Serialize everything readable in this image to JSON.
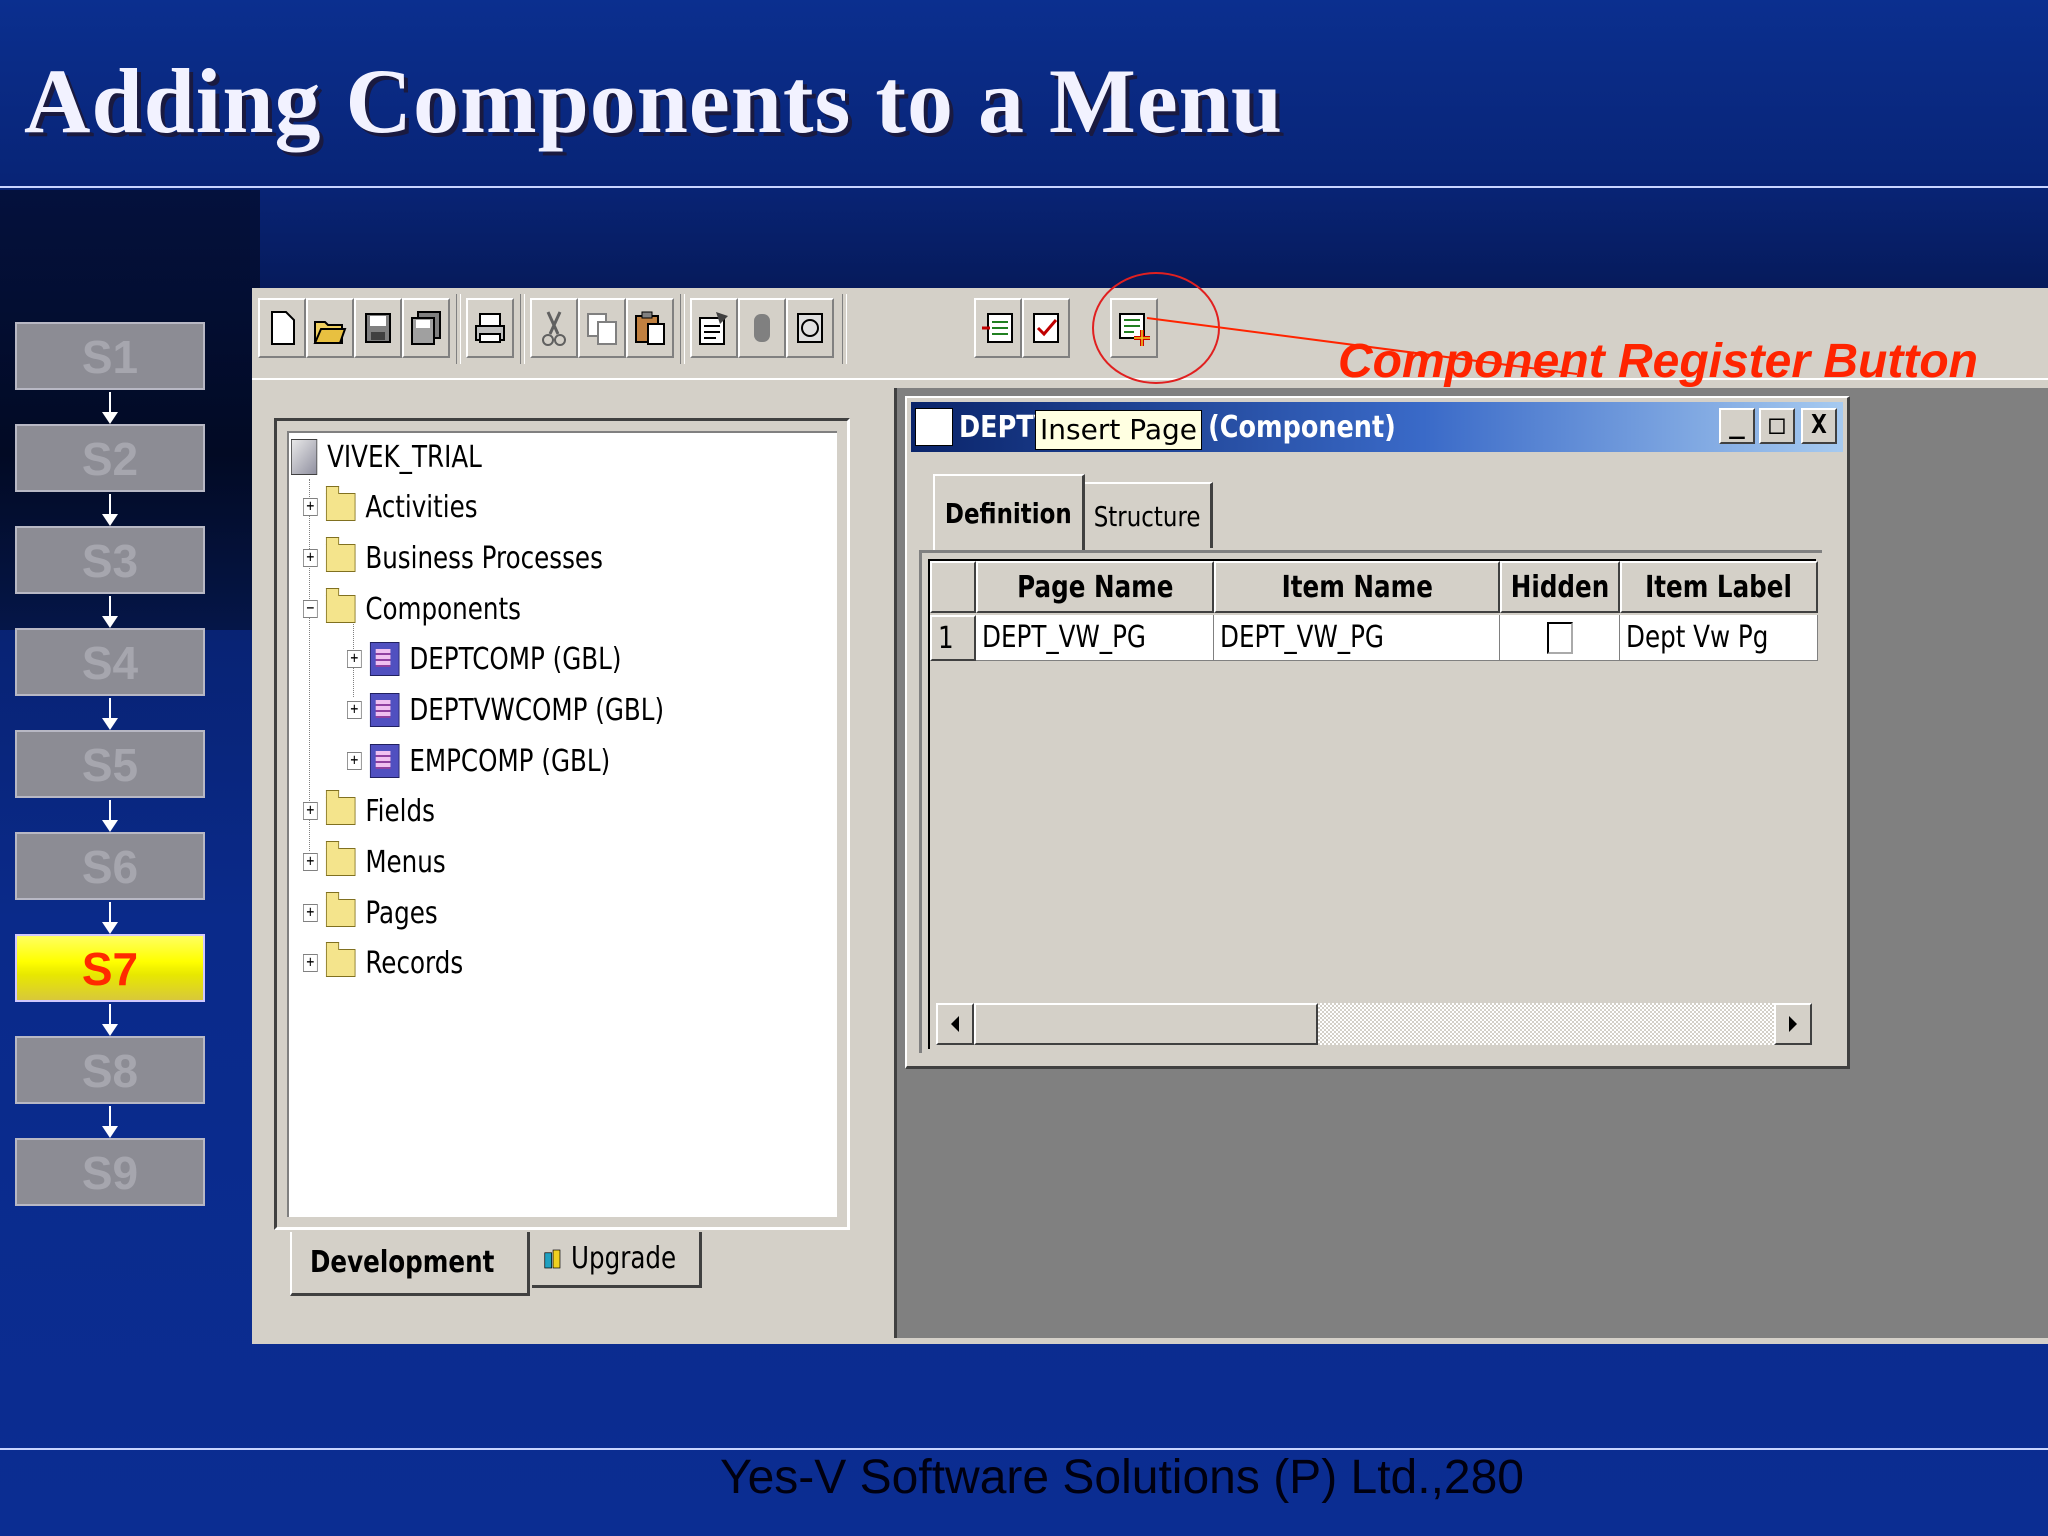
{
  "slide": {
    "title": "Adding Components to a Menu",
    "footer": "Yes-V Software Solutions (P) Ltd.,280",
    "callout": "Component Register Button"
  },
  "steps": [
    {
      "label": "S1",
      "active": false
    },
    {
      "label": "S2",
      "active": false
    },
    {
      "label": "S3",
      "active": false
    },
    {
      "label": "S4",
      "active": false
    },
    {
      "label": "S5",
      "active": false
    },
    {
      "label": "S6",
      "active": false
    },
    {
      "label": "S7",
      "active": true
    },
    {
      "label": "S8",
      "active": false
    },
    {
      "label": "S9",
      "active": false
    }
  ],
  "toolbar": {
    "buttons": [
      "new-icon",
      "open-icon",
      "save-icon",
      "save-all-icon",
      "print-icon",
      "cut-icon",
      "copy-icon",
      "paste-icon",
      "properties-icon",
      "close-icon",
      "project-icon",
      "insert-page-icon",
      "validate-icon",
      "component-register-icon"
    ]
  },
  "tree": {
    "root": "VIVEK_TRIAL",
    "activities": "Activities",
    "business_processes": "Business Processes",
    "components": "Components",
    "deptcomp": "DEPTCOMP (GBL)",
    "deptvwcomp": "DEPTVWCOMP (GBL)",
    "empcomp": "EMPCOMP (GBL)",
    "fields": "Fields",
    "menus": "Menus",
    "pages": "Pages",
    "records": "Records"
  },
  "bottom_tabs": {
    "development": "Development",
    "upgrade": "Upgrade"
  },
  "window": {
    "title_start": "DEPTV",
    "title_end": "L (Component)",
    "tooltip": "Insert Page",
    "minimize": "_",
    "maximize": "□",
    "close": "X",
    "tab_definition": "Definition",
    "tab_structure": "Structure"
  },
  "grid": {
    "headers": {
      "page_name": "Page Name",
      "item_name": "Item Name",
      "hidden": "Hidden",
      "item_label": "Item Label"
    },
    "rows": [
      {
        "num": "1",
        "page_name": "DEPT_VW_PG",
        "item_name": "DEPT_VW_PG",
        "hidden": false,
        "item_label": "Dept Vw Pg"
      }
    ]
  },
  "colors": {
    "callout": "#ff2400",
    "active_step": "#ffff00",
    "titlebar": "#0a246a"
  }
}
